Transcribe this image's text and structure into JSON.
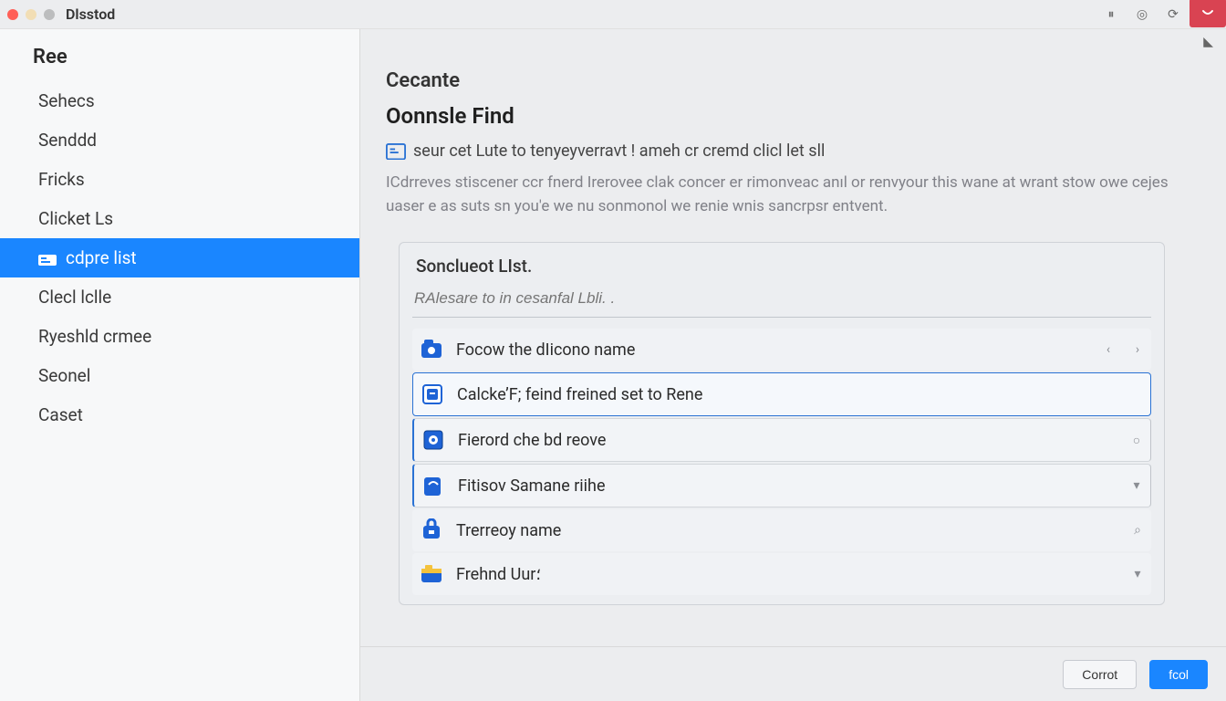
{
  "titlebar": {
    "app_name": "Dlsstod",
    "buttons": {
      "pause": "⏸",
      "target": "◎",
      "refresh": "⟳",
      "close": "✕"
    }
  },
  "sidebar": {
    "header": "Ree",
    "items": [
      {
        "label": "Sehecs"
      },
      {
        "label": "Senddd"
      },
      {
        "label": "Fricks"
      },
      {
        "label": "Clicket Ls"
      },
      {
        "label": "cdpre list",
        "active": true,
        "has_icon": true
      },
      {
        "label": "Clecl lclle"
      },
      {
        "label": "Ryeshld crmee"
      },
      {
        "label": "Seonel"
      },
      {
        "label": "Caset"
      }
    ]
  },
  "content": {
    "eyebrow": "Cecante",
    "title": "Oonnsle Find",
    "hint": "seur cet Lute to tenyeyverravt ! ameh cr cremd clicl let sll",
    "description": "ICdrreves stiscener ccr fnerd Irerovee clak concer er rimonveac anıl or renvyour this wane at wrant stow owe cejes uaser e as suts sn you'e we nu sonmonol we renie wnis sancrpsr entvent.",
    "panel_title": "Sonclueot LIst.",
    "panel_placeholder": "RAlesare to in cesanfal Lbli. .",
    "rows": [
      {
        "label": "Focow the dIicono name",
        "style": "plain"
      },
      {
        "label": "Calcke’F; feind freined set to Rene",
        "style": "selected"
      },
      {
        "label": "Fierord che bd reove",
        "style": "subsel"
      },
      {
        "label": "Fitisov Samane riihe",
        "style": "subsel"
      },
      {
        "label": "Trerreoy name",
        "style": "plain"
      },
      {
        "label": "Frehnd Uur؛",
        "style": "plain"
      }
    ]
  },
  "footer": {
    "cancel": "Corrot",
    "save": "fcol"
  }
}
